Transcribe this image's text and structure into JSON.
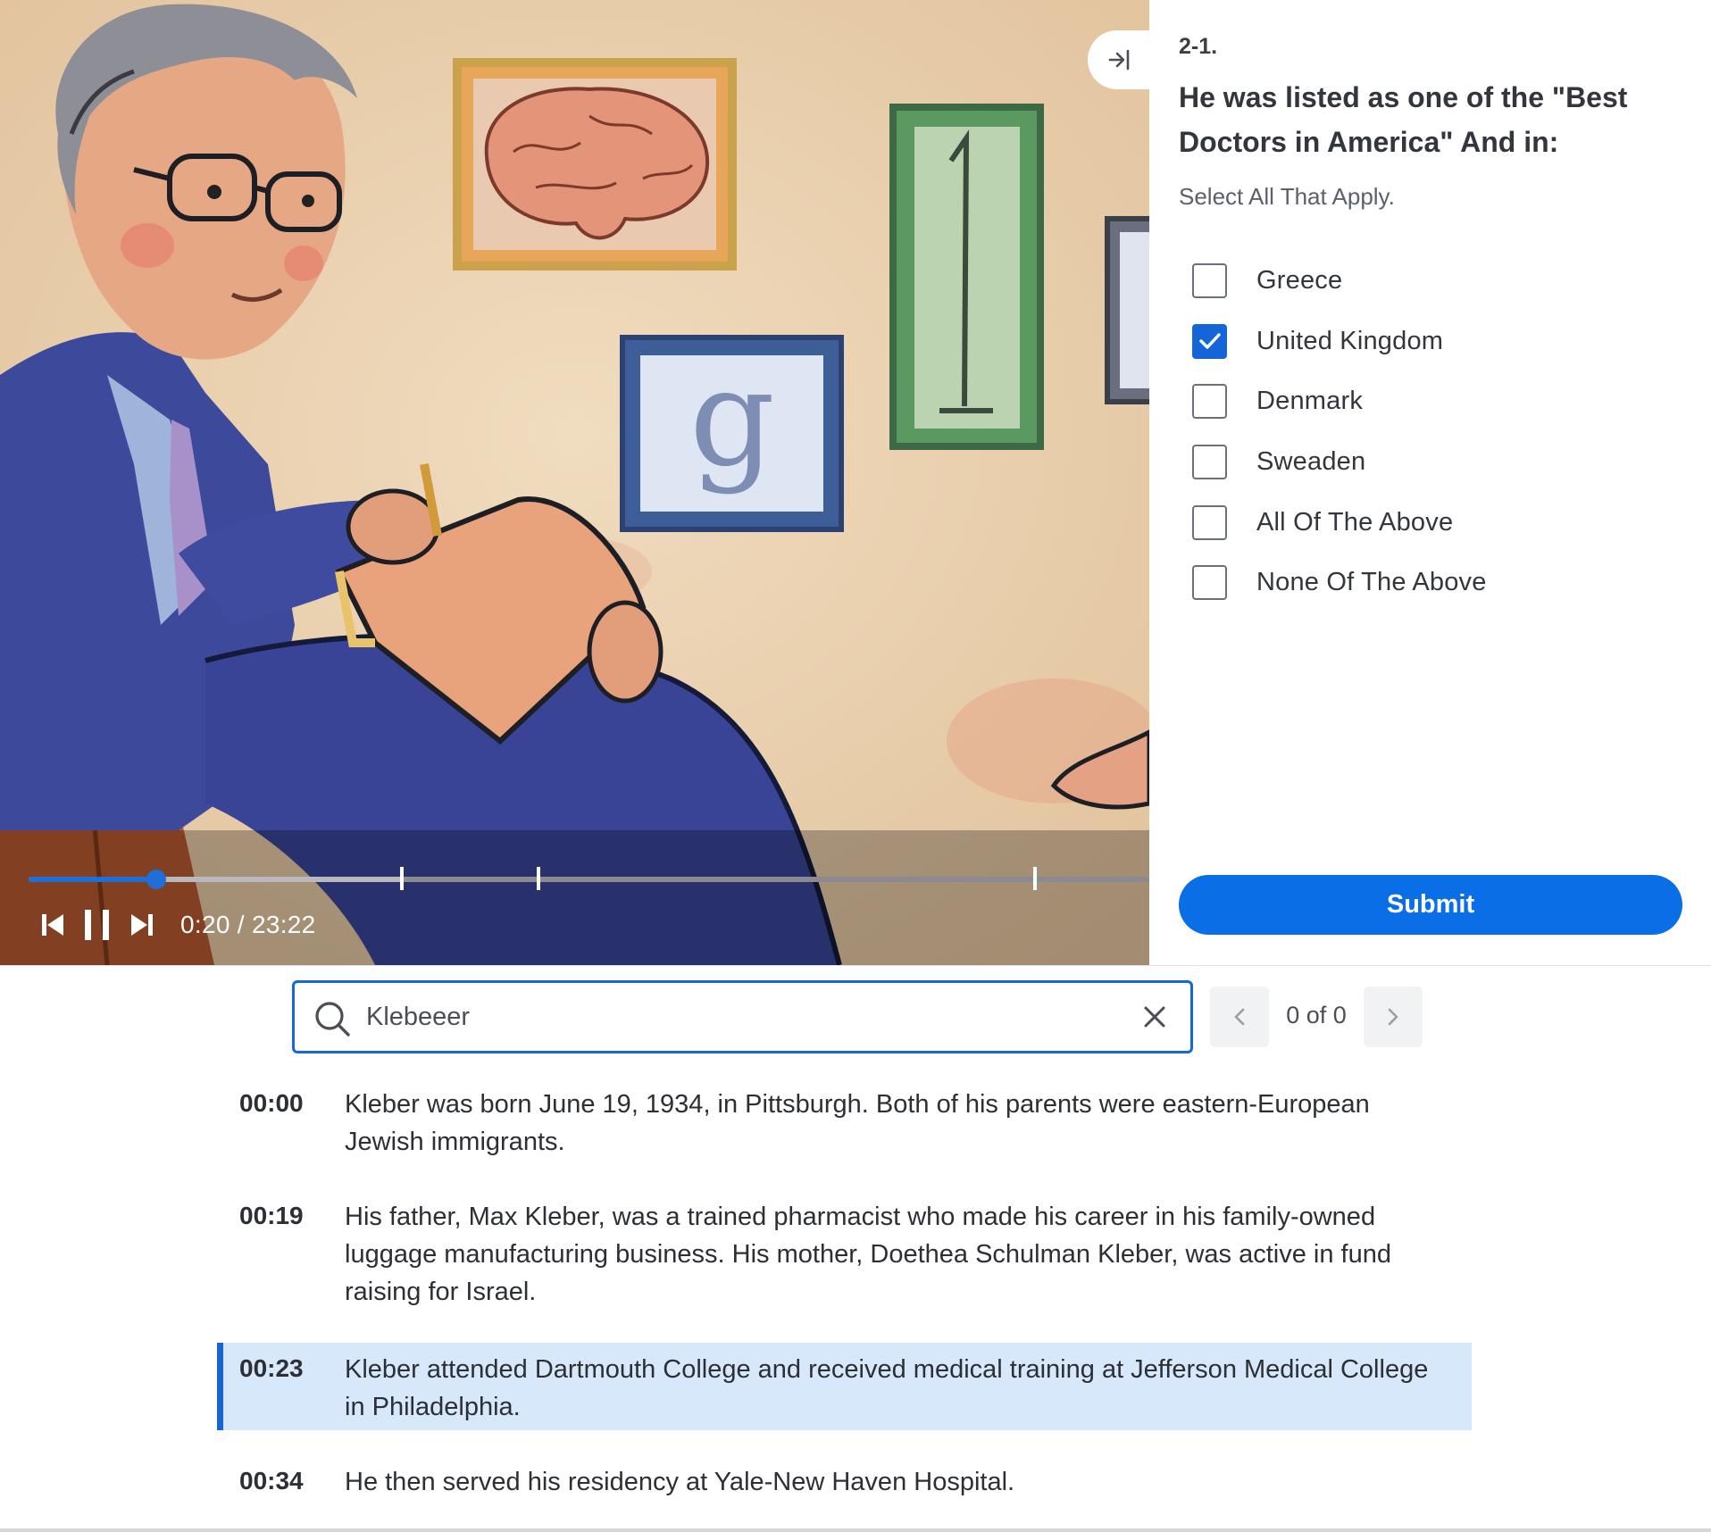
{
  "video": {
    "current_time": "0:20",
    "duration": "23:22",
    "time_separator": "/",
    "played_fraction": 0.0143,
    "buffered_fraction": 0.333,
    "chapter_marker_times_fraction": [
      0.333,
      0.455,
      0.898
    ],
    "controls": [
      "skip-back-icon",
      "pause-icon",
      "skip-forward-icon"
    ],
    "accent_color": "#1f6fd6"
  },
  "collapse_panel": {
    "icon": "collapse-right-icon"
  },
  "question": {
    "number": "2-1.",
    "text": "He was listed as one of the \"Best Doctors in America\" And in:",
    "hint": "Select All That Apply.",
    "options": [
      {
        "label": "Greece",
        "checked": false
      },
      {
        "label": "United Kingdom",
        "checked": true
      },
      {
        "label": "Denmark",
        "checked": false
      },
      {
        "label": "Sweaden",
        "checked": false
      },
      {
        "label": "All Of The Above",
        "checked": false
      },
      {
        "label": "None Of The Above",
        "checked": false
      }
    ],
    "submit_label": "Submit",
    "accent_color": "#0a6fe6"
  },
  "search": {
    "value": "Klebeeer",
    "match_count": "0 of 0",
    "icons": [
      "search-icon",
      "clear-icon",
      "chevron-left-icon",
      "chevron-right-icon"
    ]
  },
  "transcript": [
    {
      "time": "00:00",
      "text": "Kleber was born June 19, 1934, in Pittsburgh. Both of his parents were eastern-European Jewish immigrants.",
      "active": false
    },
    {
      "time": "00:19",
      "text": "His father, Max Kleber, was a trained pharmacist who made his career in his family-owned luggage manufacturing business. His mother, Doethea Schulman Kleber, was active in fund raising for Israel.",
      "active": false
    },
    {
      "time": "00:23",
      "text": "Kleber attended Dartmouth College and received medical training at Jefferson Medical College in Philadelphia.",
      "active": true
    },
    {
      "time": "00:34",
      "text": "He then served his residency at Yale-New Haven Hospital.",
      "active": false
    }
  ]
}
